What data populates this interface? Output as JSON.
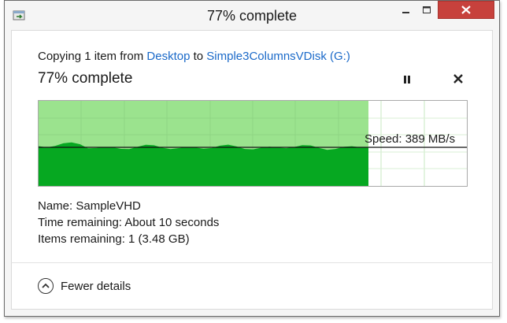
{
  "window": {
    "title": "77% complete"
  },
  "copy": {
    "prefix": "Copying 1 item from",
    "source": "Desktop",
    "to_word": "to",
    "destination": "Simple3ColumnsVDisk (G:)"
  },
  "progress": {
    "heading": "77% complete",
    "percent": 77,
    "speed_label": "Speed: 389 MB/s"
  },
  "details": {
    "name_label": "Name:",
    "name_value": "SampleVHD",
    "time_label": "Time remaining:",
    "time_value": "About 10 seconds",
    "items_label": "Items remaining:",
    "items_value": "1 (3.48 GB)"
  },
  "footer": {
    "toggle_label": "Fewer details"
  },
  "colors": {
    "progress_fill": "#9be38e",
    "speed_fill": "#06a821",
    "grid": "#c7e8c2",
    "close_button": "#c7413c",
    "link": "#1b6ac9"
  },
  "icons": {
    "app": "copy-files-icon",
    "pause": "pause-icon",
    "cancel": "close-icon",
    "toggle": "chevron-up-icon"
  }
}
